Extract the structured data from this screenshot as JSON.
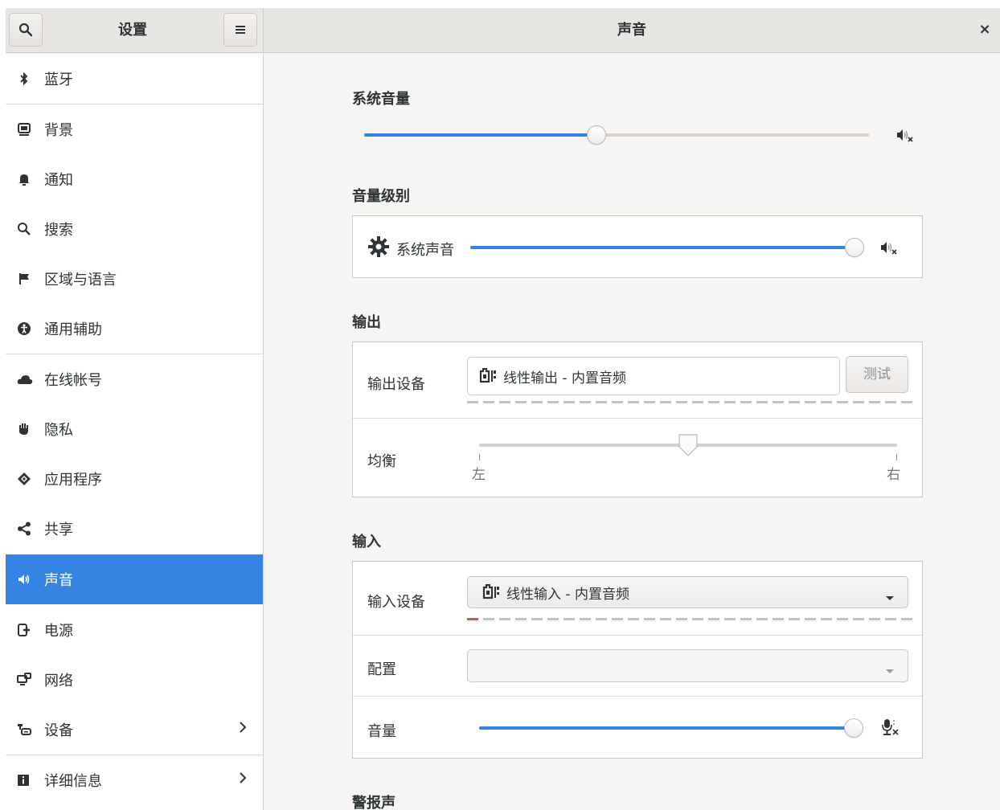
{
  "window": {
    "settings_title": "设置",
    "panel_title": "声音",
    "close_label": "×"
  },
  "sidebar": {
    "items": [
      {
        "label": "蓝牙",
        "icon": "bluetooth-icon"
      },
      {
        "label": "背景",
        "icon": "background-icon"
      },
      {
        "label": "通知",
        "icon": "bell-icon"
      },
      {
        "label": "搜索",
        "icon": "search-icon"
      },
      {
        "label": "区域与语言",
        "icon": "flag-icon"
      },
      {
        "label": "通用辅助",
        "icon": "accessibility-icon"
      },
      {
        "label": "在线帐号",
        "icon": "cloud-icon"
      },
      {
        "label": "隐私",
        "icon": "hand-icon"
      },
      {
        "label": "应用程序",
        "icon": "apps-icon"
      },
      {
        "label": "共享",
        "icon": "share-icon"
      },
      {
        "label": "声音",
        "icon": "speaker-icon",
        "active": true
      },
      {
        "label": "电源",
        "icon": "power-icon"
      },
      {
        "label": "网络",
        "icon": "network-icon"
      },
      {
        "label": "设备",
        "icon": "devices-icon",
        "has_chevron": true
      },
      {
        "label": "详细信息",
        "icon": "info-icon",
        "has_chevron": true
      }
    ]
  },
  "sound": {
    "system_volume": {
      "title": "系统音量",
      "level": 0.46,
      "icon": "speaker-muted-icon"
    },
    "volume_levels": {
      "title": "音量级别",
      "system_sounds_label": "系统声音",
      "level": 1.0,
      "icon": "speaker-muted-icon"
    },
    "output": {
      "title": "输出",
      "device_label": "输出设备",
      "device_value": "线性输出 - 内置音频",
      "test_button": "测试",
      "balance_label": "均衡",
      "balance_left": "左",
      "balance_right": "右",
      "balance_level": 0.5
    },
    "input": {
      "title": "输入",
      "device_label": "输入设备",
      "device_value": "线性输入 - 内置音频",
      "config_label": "配置",
      "config_value": "",
      "volume_label": "音量",
      "volume_level": 1.0,
      "mic_icon": "microphone-muted-icon"
    },
    "alert": {
      "title": "警报声"
    }
  },
  "colors": {
    "accent": "#3584e4",
    "header_bg": "#e8e6e3",
    "sidebar_bg": "#ffffff",
    "content_bg": "#f6f5f4"
  }
}
